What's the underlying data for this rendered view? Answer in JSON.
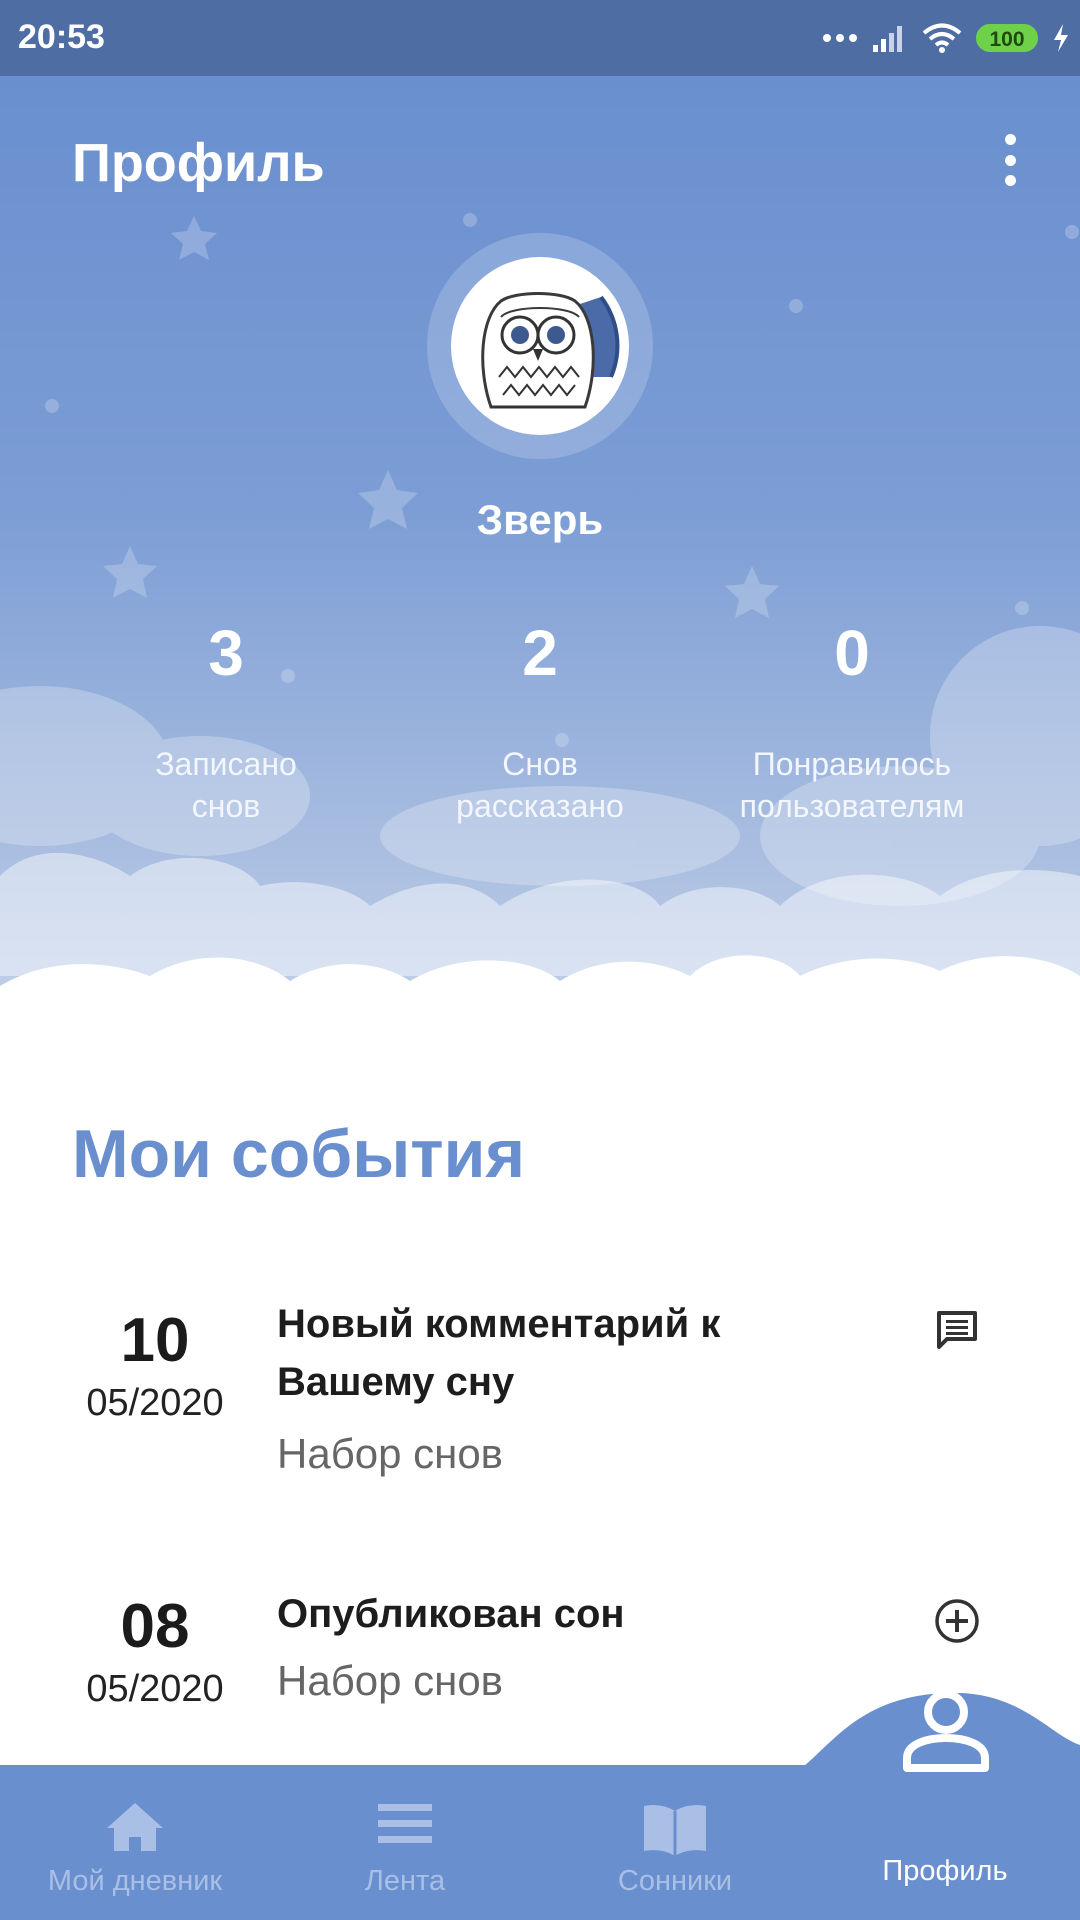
{
  "status_bar": {
    "time": "20:53",
    "battery": "100"
  },
  "header": {
    "title": "Профиль",
    "menu_icon": "more-vertical-icon"
  },
  "profile": {
    "avatar_icon": "owl-avatar",
    "name": "Зверь"
  },
  "stats": [
    {
      "value": "3",
      "label": "Записано\nснов"
    },
    {
      "value": "2",
      "label": "Снов\nрассказано"
    },
    {
      "value": "0",
      "label": "Понравилось\nпользователям"
    }
  ],
  "events": {
    "title": "Мои события",
    "items": [
      {
        "day": "10",
        "month": "05/2020",
        "title": "Новый комментарий к Вашему сну",
        "subtitle": "Набор снов",
        "icon": "comment-icon"
      },
      {
        "day": "08",
        "month": "05/2020",
        "title": "Опубликован сон",
        "subtitle": "Набор снов",
        "icon": "plus-circle-icon"
      }
    ]
  },
  "bottom_nav": {
    "items": [
      {
        "label": "Мой дневник",
        "icon": "home-icon",
        "active": false
      },
      {
        "label": "Лента",
        "icon": "feed-icon",
        "active": false
      },
      {
        "label": "Сонники",
        "icon": "book-icon",
        "active": false
      },
      {
        "label": "Профиль",
        "icon": "person-icon",
        "active": true
      }
    ]
  },
  "colors": {
    "accent": "#6a8fcf",
    "status_bar": "#4e6da3",
    "inactive_nav": "#a9bfe6"
  }
}
